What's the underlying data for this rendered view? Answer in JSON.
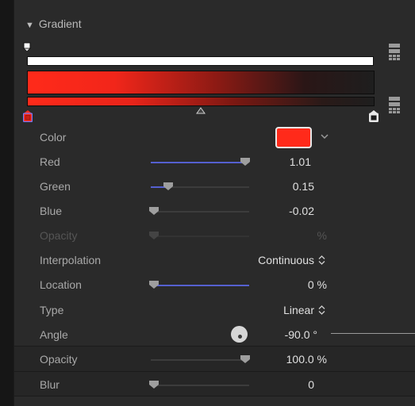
{
  "section": {
    "title": "Gradient"
  },
  "rows": {
    "color": {
      "label": "Color",
      "swatch_color": "#ff2a1a"
    },
    "red": {
      "label": "Red",
      "value": "1.01",
      "fill": 1.0
    },
    "green": {
      "label": "Green",
      "value": "0.15",
      "fill": 0.15
    },
    "blue": {
      "label": "Blue",
      "value": "-0.02",
      "fill": 0.0
    },
    "stop_opacity": {
      "label": "Opacity",
      "value": "%"
    },
    "interpolation": {
      "label": "Interpolation",
      "value": "Continuous"
    },
    "location": {
      "label": "Location",
      "value": "0 %",
      "fill": 0.0
    },
    "type": {
      "label": "Type",
      "value": "Linear"
    },
    "angle": {
      "label": "Angle",
      "value": "-90.0 °"
    },
    "opacity": {
      "label": "Opacity",
      "value": "100.0 %",
      "fill": 1.0
    },
    "blur": {
      "label": "Blur",
      "value": "0",
      "fill": 0.0
    }
  },
  "colors": {
    "accent": "#5560d0",
    "gradient_start": "#ff2a1a",
    "gradient_end": "#1e1e1e"
  }
}
